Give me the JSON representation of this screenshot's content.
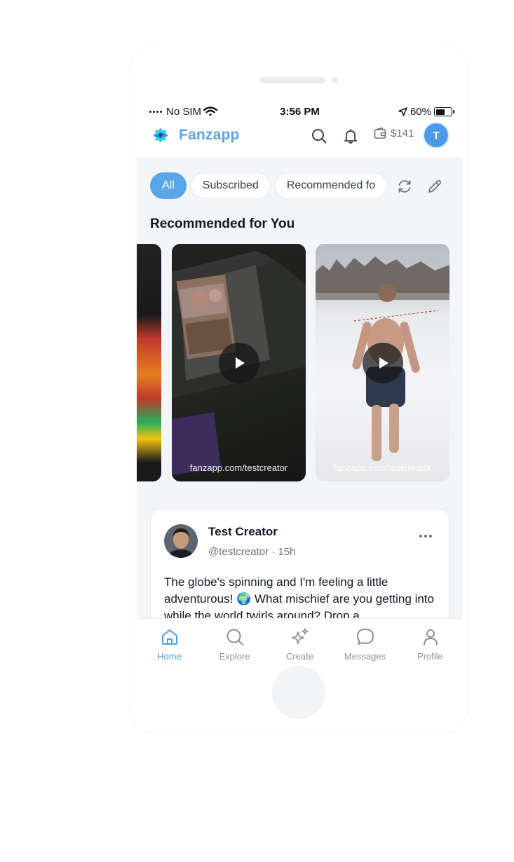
{
  "status_bar": {
    "carrier": "No SIM",
    "time": "3:56 PM",
    "battery": "60%",
    "battery_level": 0.6
  },
  "header": {
    "app_name": "Fanzapp",
    "wallet_balance": "$141",
    "avatar_initial": "T",
    "icons": [
      "logo-icon",
      "search-icon",
      "bell-icon",
      "wallet-icon"
    ]
  },
  "filters": {
    "chips": [
      "All",
      "Subscribed",
      "Recommended fo"
    ],
    "active_index": 0,
    "icons": [
      "refresh-icon",
      "edit-icon"
    ]
  },
  "recommended": {
    "title": "Recommended for You",
    "reels": [
      {
        "caption": ""
      },
      {
        "caption": "fanzapp.com/testcreator"
      },
      {
        "caption": "fanzapp.com/testcreator"
      }
    ]
  },
  "post": {
    "author_name": "Test Creator",
    "meta": "@testcreator · 15h",
    "text": "The globe's spinning and I'm feeling a little adventurous! 🌍 What mischief are you getting into while the world twirls around? Drop a"
  },
  "tab_bar": {
    "active": "Home",
    "tabs": [
      {
        "label": "Home",
        "icon": "home-icon"
      },
      {
        "label": "Explore",
        "icon": "search-icon"
      },
      {
        "label": "Create",
        "icon": "sparkle-icon"
      },
      {
        "label": "Messages",
        "icon": "chat-bubble-icon"
      },
      {
        "label": "Profile",
        "icon": "person-icon"
      }
    ]
  },
  "colors": {
    "accent": "#5aa6ea",
    "feed_background": "#f3f5f9",
    "text_primary": "#111827",
    "text_secondary": "#6b7280"
  }
}
